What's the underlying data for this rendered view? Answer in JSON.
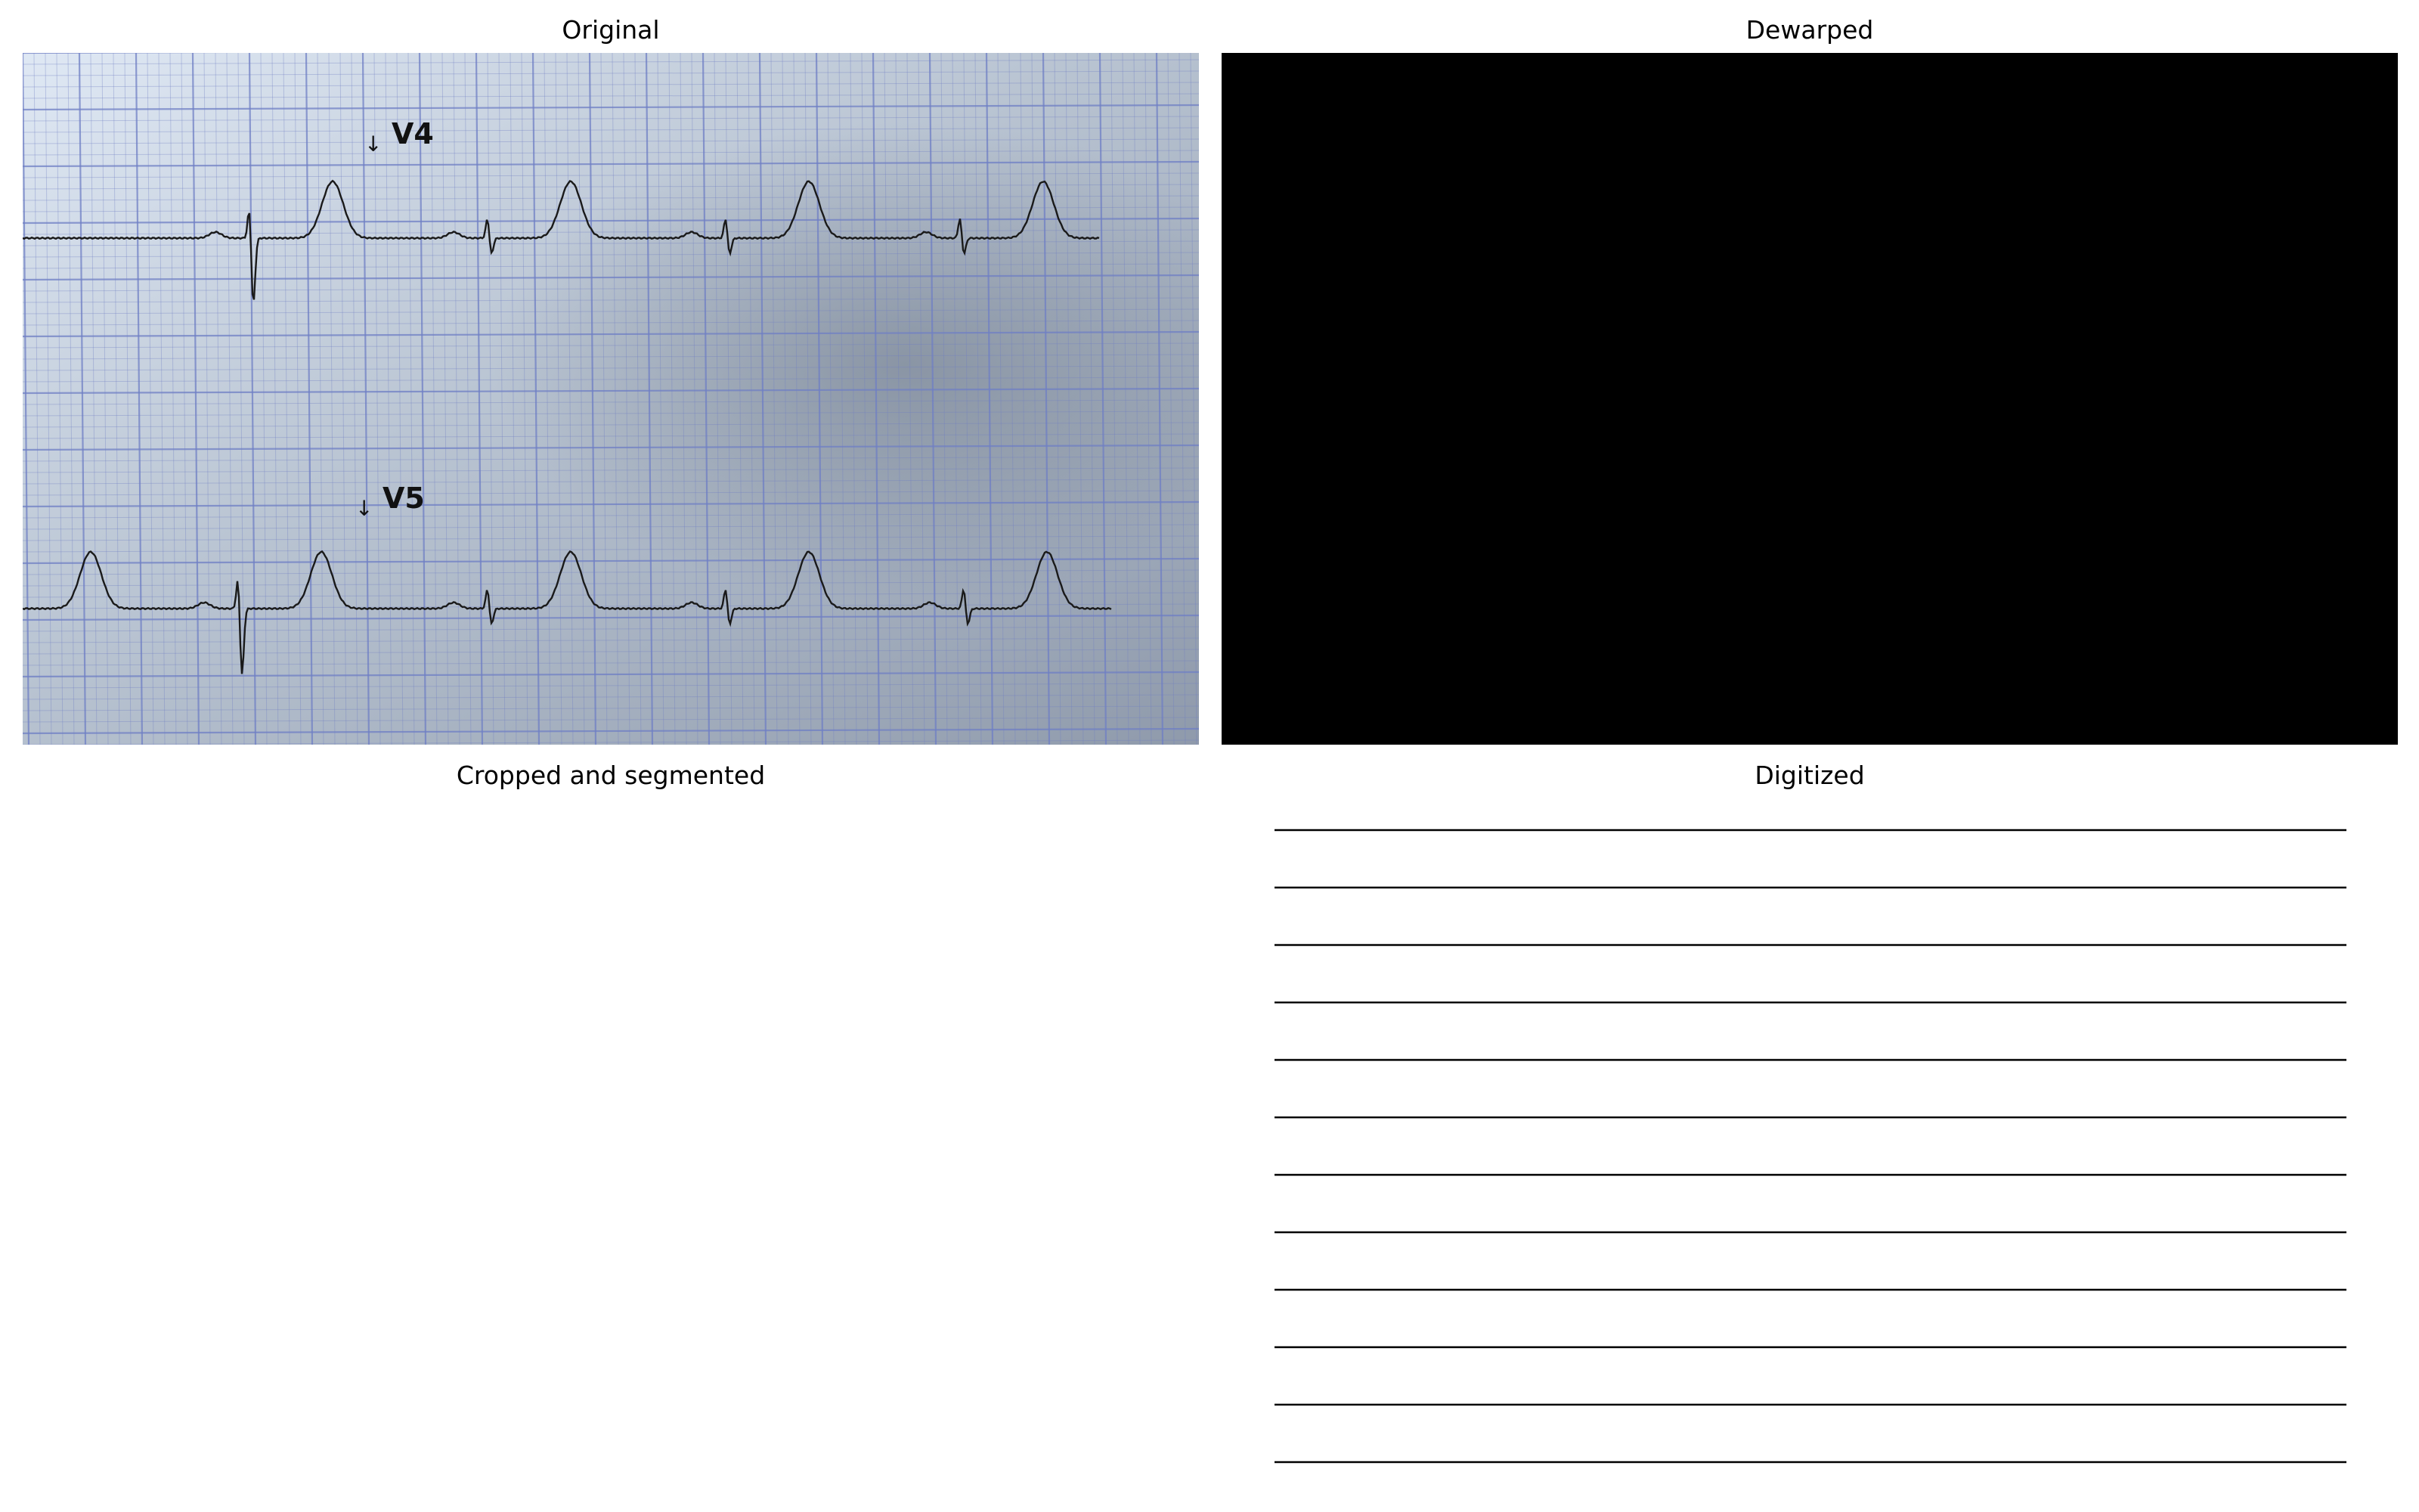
{
  "figure": {
    "panels": [
      {
        "title": "Original"
      },
      {
        "title": "Dewarped"
      },
      {
        "title": "Cropped and segmented"
      },
      {
        "title": "Digitized"
      }
    ]
  },
  "original": {
    "leads": [
      {
        "label": "V4",
        "arrow": "↓"
      },
      {
        "label": "V5",
        "arrow": "↓"
      }
    ],
    "paper_color": "#bcc8d8",
    "grid_color": "#6f7fc4",
    "trace_color": "#1a1a1a"
  },
  "dewarped": {
    "fill_color": "#000000"
  },
  "digitized": {
    "line_count": 12,
    "line_color": "#000000"
  }
}
